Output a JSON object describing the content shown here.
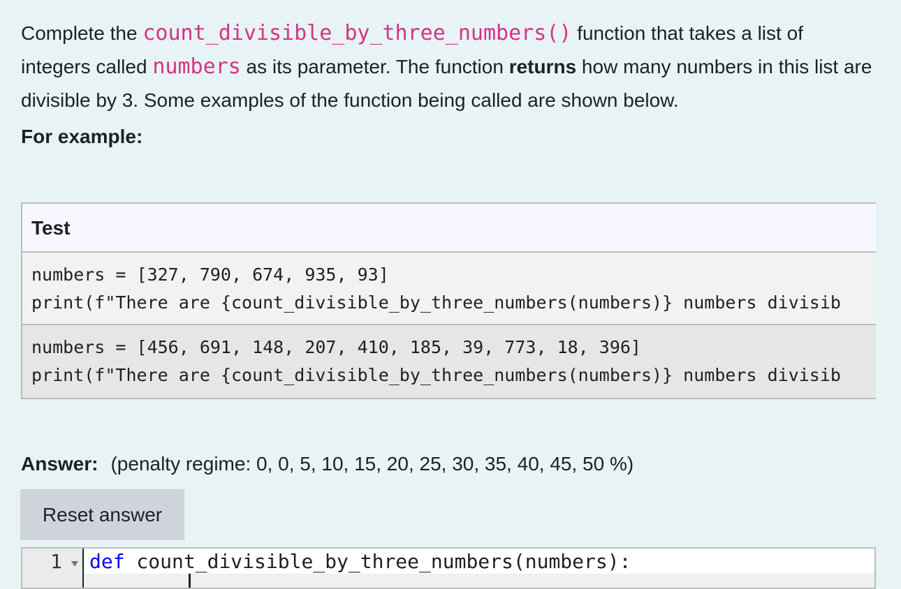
{
  "question": {
    "part1": "Complete the ",
    "func_name": "count_divisible_by_three_numbers()",
    "part2": " function that takes a list of integers called ",
    "param_name": "numbers",
    "part3": " as its parameter. The function ",
    "bold_word": "returns",
    "part4": " how many numbers in this list are divisible by 3. Some examples of the function being called are shown below."
  },
  "for_example_label": "For example:",
  "examples": {
    "header": "Test",
    "rows": [
      {
        "line1": "numbers = [327, 790, 674, 935, 93]",
        "line2": "print(f\"There are {count_divisible_by_three_numbers(numbers)} numbers divisib"
      },
      {
        "line1": "numbers = [456, 691, 148, 207, 410, 185, 39, 773, 18, 396]",
        "line2": "print(f\"There are {count_divisible_by_three_numbers(numbers)} numbers divisib"
      }
    ]
  },
  "answer": {
    "label": "Answer:",
    "penalty": "(penalty regime: 0, 0, 5, 10, 15, 20, 25, 30, 35, 40, 45, 50 %)"
  },
  "reset_button_label": "Reset answer",
  "editor": {
    "line_number": "1",
    "keyword": "def",
    "code_rest": " count_divisible_by_three_numbers(numbers):"
  },
  "colors": {
    "background": "#e7f3f5",
    "code_highlight": "#d63384",
    "keyword": "#0000ff",
    "button_bg": "#ced4da"
  }
}
